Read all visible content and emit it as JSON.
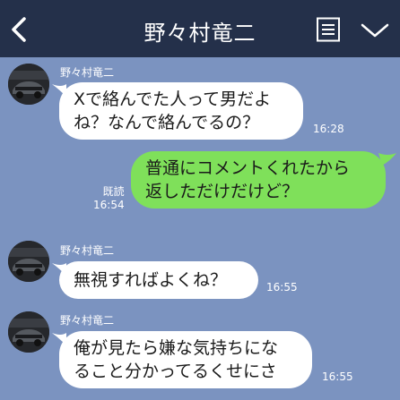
{
  "header": {
    "title": "野々村竜二",
    "back_icon": "chevron-left-icon",
    "menu_icon": "notes-menu-icon",
    "expand_icon": "chevron-down-icon",
    "background": "#24304a"
  },
  "colors": {
    "chat_background": "#7b93c0",
    "incoming_bubble": "#ffffff",
    "outgoing_bubble": "#7fe05a"
  },
  "messages": [
    {
      "direction": "incoming",
      "sender": "野々村竜二",
      "lines": [
        "Xで絡んでた人って男だよ",
        "ね？なんで絡んでるの？"
      ],
      "time": "16:28"
    },
    {
      "direction": "outgoing",
      "lines": [
        "普通にコメントくれたから",
        "返しただけだけど？"
      ],
      "read": "既読",
      "time": "16:54"
    },
    {
      "direction": "incoming",
      "sender": "野々村竜二",
      "lines": [
        "無視すればよくね？"
      ],
      "time": "16:55"
    },
    {
      "direction": "incoming",
      "sender": "野々村竜二",
      "lines": [
        "俺が見たら嫌な気持ちにな",
        "ること分かってるくせにさ"
      ],
      "time": "16:55"
    }
  ]
}
